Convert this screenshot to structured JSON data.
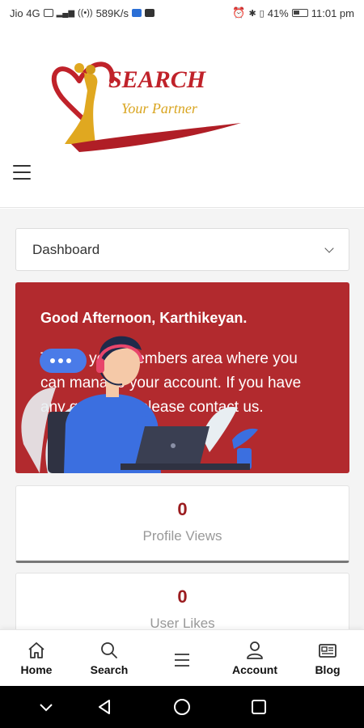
{
  "status_bar": {
    "carrier": "Jio 4G",
    "speed": "589K/s",
    "battery": "41%",
    "time": "11:01 pm"
  },
  "header": {
    "logo_text": "SEARCH",
    "logo_tagline": "Your Partner"
  },
  "dashboard": {
    "select_value": "Dashboard",
    "welcome": {
      "greeting": "Good Afternoon, Karthikeyan.",
      "message": "This is your members area where you can manage your account. If you have any questions please contact us."
    },
    "stats": [
      {
        "value": "0",
        "label": "Profile Views"
      },
      {
        "value": "0",
        "label": "User Likes"
      }
    ]
  },
  "bottom_nav": [
    {
      "label": "Home",
      "icon": "home-icon"
    },
    {
      "label": "Search",
      "icon": "search-icon"
    },
    {
      "label": "",
      "icon": "menu-icon"
    },
    {
      "label": "Account",
      "icon": "user-icon"
    },
    {
      "label": "Blog",
      "icon": "newspaper-icon"
    }
  ],
  "colors": {
    "brand_red": "#b22a2e",
    "stat_value": "#9b1c1f",
    "logo_gold": "#d9a520"
  }
}
